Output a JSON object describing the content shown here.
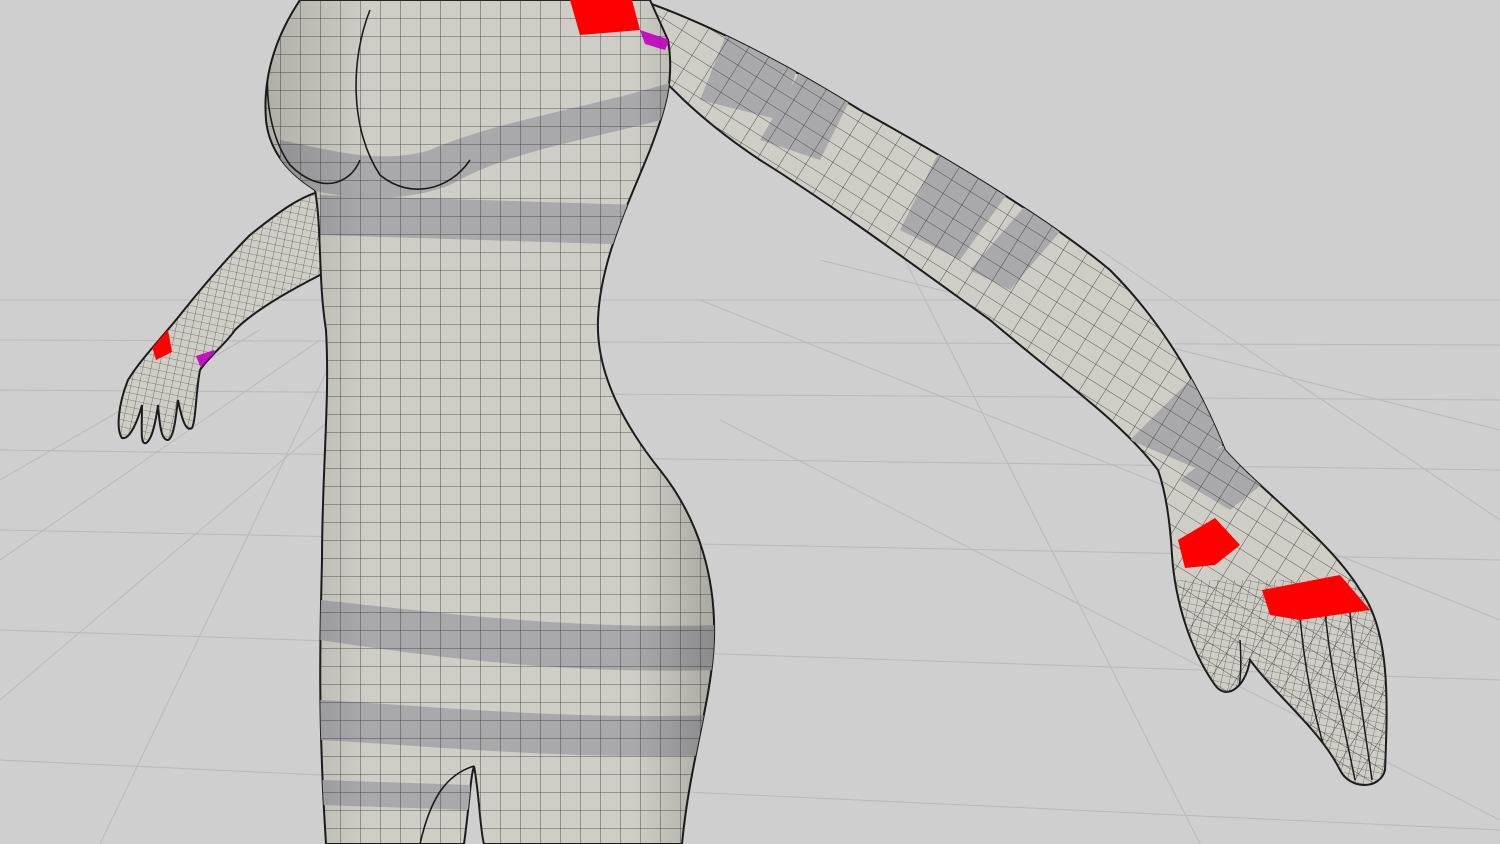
{
  "viewport": {
    "colors": {
      "background": "#cfcfcf",
      "ground_grid": "#b9b9b9",
      "mesh_surface": "#cfcec6",
      "mesh_band": "#a9a9ab",
      "wire": "#2f2f2f",
      "outline": "#1c1c1c",
      "pole_highlight": "#ff0000",
      "edge_highlight": "#c000c0"
    },
    "icons": {
      "model": "humanoid-wireframe-mesh-icon",
      "grid": "ground-grid-icon"
    },
    "highlights": [
      "shoulder-poles",
      "right-wrist-poles",
      "right-knuckle-poles",
      "left-wrist-poles"
    ]
  }
}
